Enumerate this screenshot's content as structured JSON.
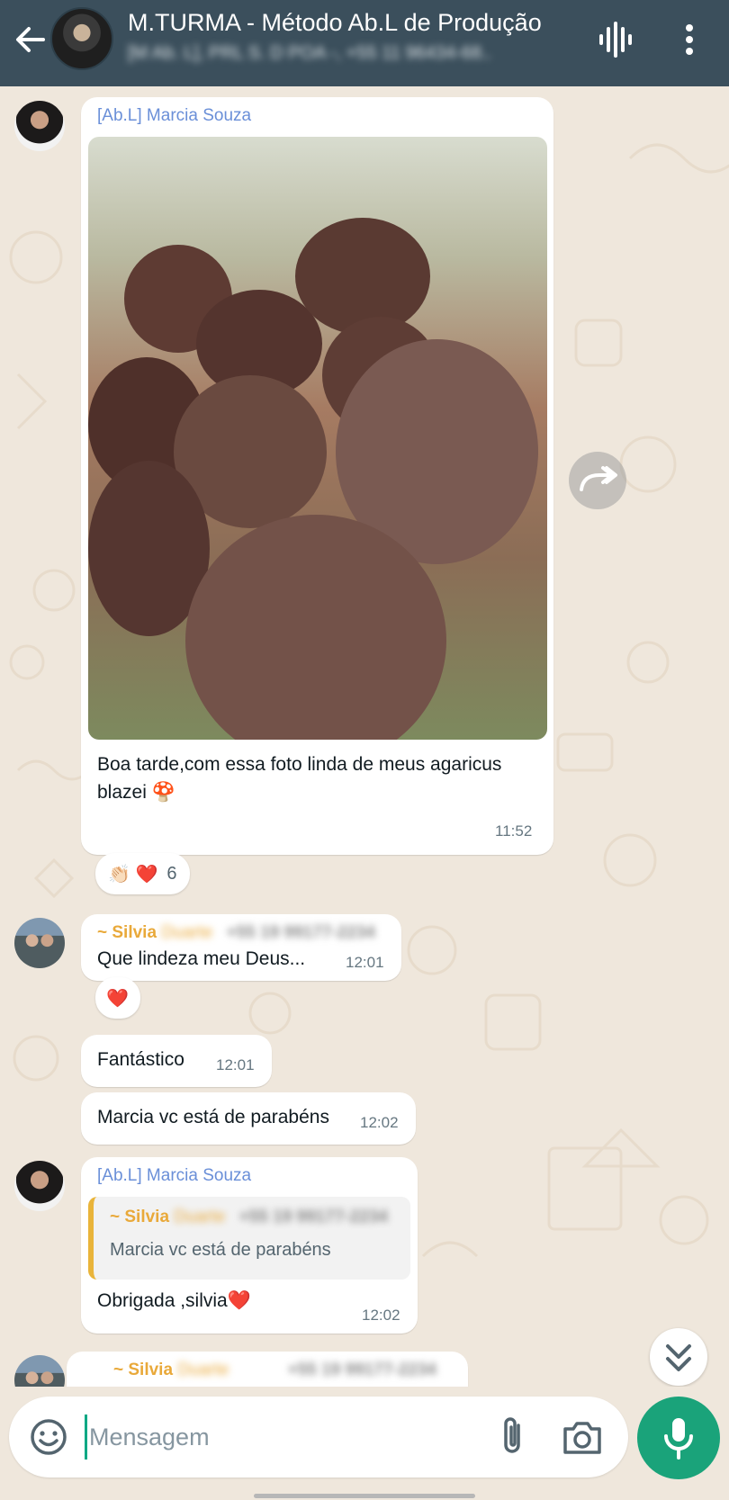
{
  "header": {
    "title": "M.TURMA - Método Ab.L de Produção",
    "subtitle": "[M Ab. L], PRL S. D POA -, +55 11 96434-68..",
    "back_icon": "arrow-left-icon",
    "voice_icon": "voice-waveform-icon",
    "menu_icon": "more-vert-icon"
  },
  "colors": {
    "header_bg": "#3b4f5c",
    "chat_bg": "#efe7dc",
    "accent_green": "#1aa37a",
    "sender_blue": "#6a8fd8",
    "sender_orange": "#e9a93a"
  },
  "messages": [
    {
      "sender": "[Ab.L] Marcia Souza",
      "text": "Boa tarde,com essa foto linda de meus agaricus blazei 🍄",
      "time": "11:52",
      "reactions": {
        "emojis": "👏🏻 ❤️",
        "count": "6"
      }
    },
    {
      "sender": "~ Silvia",
      "sender_hidden": "Duarte",
      "phone": "+55 19 99177-2234",
      "text": "Que lindeza meu Deus...",
      "time": "12:01",
      "reaction": "❤️"
    },
    {
      "text": "Fantástico",
      "time": "12:01"
    },
    {
      "text": "Marcia vc está de parabéns",
      "time": "12:02"
    },
    {
      "sender": "[Ab.L] Marcia Souza",
      "quote_sender": "~ Silvia",
      "quote_sender_hidden": "Duarte",
      "quote_phone": "+55 19 99177-2234",
      "quote_text": "Marcia vc está de parabéns",
      "text": "Obrigada ,silvia❤️",
      "time": "12:02"
    },
    {
      "sender": "~ Silvia",
      "sender_hidden": "Duarte",
      "phone": "+55 19 99177-2234"
    }
  ],
  "input": {
    "placeholder": "Mensagem",
    "value": "",
    "emoji_icon": "emoji-icon",
    "attach_icon": "paperclip-icon",
    "camera_icon": "camera-icon",
    "mic_icon": "microphone-icon"
  }
}
